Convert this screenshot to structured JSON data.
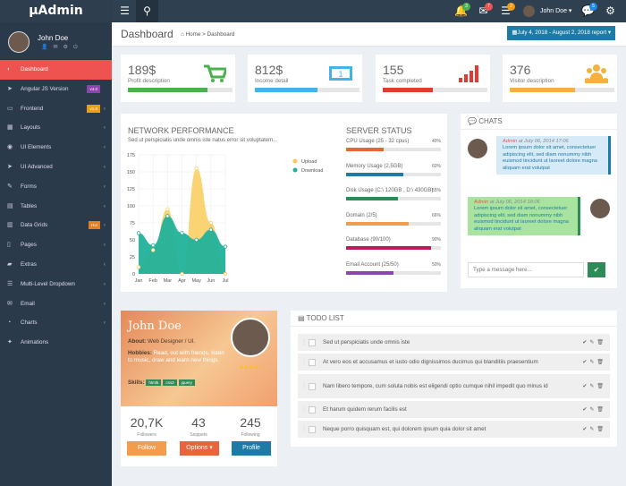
{
  "brand": "µAdmin",
  "topbar": {
    "user": "John Doe",
    "badges": [
      "3",
      "7",
      "2",
      "5"
    ]
  },
  "sidebar": {
    "user": "John Doe",
    "items": [
      {
        "label": "Dashboard",
        "icon": "palette-icon",
        "active": true
      },
      {
        "label": "Angular JS Version",
        "icon": "paper-plane-icon",
        "tag": "v4.0",
        "tag_color": "#8e44ad"
      },
      {
        "label": "Frontend",
        "icon": "monitor-icon",
        "tag": "v1.0",
        "tag_color": "#f39c12",
        "chevron": true
      },
      {
        "label": "Layouts",
        "icon": "layout-icon",
        "chevron": true
      },
      {
        "label": "UI Elements",
        "icon": "eye-icon",
        "chevron": true
      },
      {
        "label": "UI Advanced",
        "icon": "paper-plane-icon",
        "chevron": true
      },
      {
        "label": "Forms",
        "icon": "edit-icon",
        "chevron": true
      },
      {
        "label": "Tables",
        "icon": "table-icon",
        "chevron": true
      },
      {
        "label": "Data Grids",
        "icon": "grid-icon",
        "tag": "Hot",
        "tag_color": "#e67e22",
        "chevron": true
      },
      {
        "label": "Pages",
        "icon": "file-icon",
        "chevron": true
      },
      {
        "label": "Extras",
        "icon": "folder-icon",
        "chevron": true
      },
      {
        "label": "Multi-Level Dropdown",
        "icon": "list-icon",
        "chevron": true
      },
      {
        "label": "Email",
        "icon": "envelope-icon",
        "chevron": true
      },
      {
        "label": "Charts",
        "icon": "chart-icon",
        "chevron": true
      },
      {
        "label": "Animations",
        "icon": "magic-icon",
        "chevron": false
      }
    ]
  },
  "header": {
    "title": "Dashboard",
    "breadcrumb_home": "Home",
    "breadcrumb_sep": ">",
    "breadcrumb_current": "Dashboard",
    "date_range": "July 4, 2018 - August 2, 2018 report"
  },
  "stats": [
    {
      "value": "189$",
      "label": "Profit description",
      "color": "#4caf50",
      "progress": 0.76
    },
    {
      "value": "812$",
      "label": "Income detail",
      "color": "#42b4e6",
      "progress": 0.6
    },
    {
      "value": "155",
      "label": "Task completed",
      "color": "#e53935",
      "progress": 0.48
    },
    {
      "value": "376",
      "label": "Visitor description",
      "color": "#f4b13e",
      "progress": 0.62
    }
  ],
  "network": {
    "title": "NETWORK PERFORMANCE",
    "subtitle": "Sed ut perspiciatis unde omnis iste natus error sit voluptatem..."
  },
  "chart_data": {
    "type": "area",
    "x": [
      "Jan",
      "Feb",
      "Mar",
      "Apr",
      "May",
      "Jun",
      "Jul"
    ],
    "ylim": [
      0,
      175
    ],
    "yticks": [
      0,
      25,
      50,
      75,
      100,
      125,
      150,
      175
    ],
    "series": [
      {
        "name": "Upload",
        "color": "#f9cb5a",
        "values": [
          10,
          35,
          95,
          0,
          155,
          75,
          0
        ]
      },
      {
        "name": "Download",
        "color": "#21b19a",
        "values": [
          60,
          42,
          85,
          60,
          50,
          65,
          40
        ]
      }
    ]
  },
  "server": {
    "title": "SERVER STATUS",
    "items": [
      {
        "label": "CPU Usage (25 - 32 cpus)",
        "pct": "40%",
        "color": "#e8643c",
        "value": 0.4
      },
      {
        "label": "Memory Usage (2.5GB)",
        "pct": "60%",
        "color": "#1e7ba5",
        "value": 0.6
      },
      {
        "label": "Disk Usage (C:\\ 120GB , D:\\ 430GB)",
        "pct": "55%",
        "color": "#2e8b57",
        "value": 0.55
      },
      {
        "label": "Domain (2/5)",
        "pct": "66%",
        "color": "#f39c4e",
        "value": 0.66
      },
      {
        "label": "Database (90/100)",
        "pct": "90%",
        "color": "#c2185b",
        "value": 0.9
      },
      {
        "label": "Email Account (25/50)",
        "pct": "50%",
        "color": "#8e44ad",
        "value": 0.5
      }
    ]
  },
  "chats": {
    "title": "CHATS",
    "messages": [
      {
        "author": "Admin",
        "time": "at July 06, 2014 17:06",
        "text": "Lorem ipsum dolor sit amet, consectetuer adipiscing elit, sed diam nonummy nibh euismod tincidunt ut laoreet dolore magna aliquam erat volutpat"
      },
      {
        "author": "Admin",
        "time": "at July 06, 2014 18:06",
        "text": "Lorem ipsum dolor sit amet, consectetuer adipiscing elit, sed diam nonummy nibh euismod tincidunt ut laoreet dolore magna aliquam erat volutpat"
      }
    ],
    "placeholder": "Type a message here..."
  },
  "profile": {
    "name": "John Doe",
    "about_label": "About:",
    "about": "Web Designer / UI.",
    "hobbies_label": "Hobbies:",
    "hobbies": "Read, out with friends, listen to music, draw and learn new things.",
    "skills_label": "Skills:",
    "skills": [
      "html5",
      "css3",
      "jquery"
    ],
    "stats": [
      {
        "value": "20,7K",
        "label": "Followers"
      },
      {
        "value": "43",
        "label": "Snippets"
      },
      {
        "value": "245",
        "label": "Following"
      }
    ],
    "follow": "Follow",
    "options": "Options",
    "profile_btn": "Profile"
  },
  "todo": {
    "title": "TODO LIST",
    "items": [
      "Sed ut perspiciatis unde omnis iste",
      "At vero eos et accusamus et iusto odio dignissimos ducimus qui blanditiis praesentium",
      "Nam libero tempore, cum soluta nobis est eligendi optio cumque nihil impedit quo minus id",
      "Et harum quidem rerum facilis est",
      "Neque porro quisquam est, qui dolorem ipsum quia dolor sit amet"
    ]
  }
}
